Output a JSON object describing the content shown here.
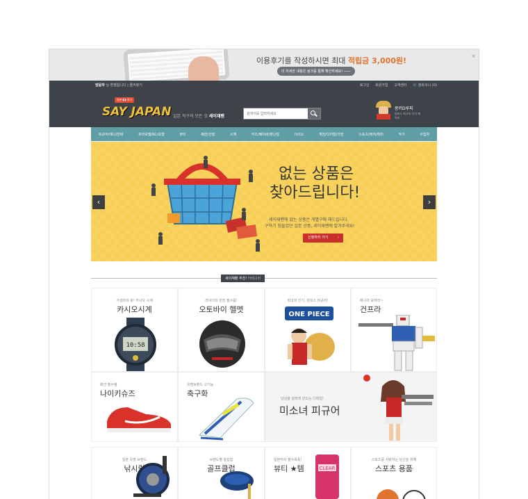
{
  "promo": {
    "text_prefix": "이용후기를 작성하시면 최대 ",
    "text_highlight": "적립금 3,000원!",
    "sub_button": "더 자세한 내용은 링크를 통해 확인하세요!  ――",
    "close": "×"
  },
  "topbar": {
    "greeting_name": "방문자",
    "greeting_text": " 님 환영합니다  |  즐겨찾기",
    "links": [
      "로그인",
      "회원가입",
      "고객센터",
      "🛒 장바구니 (0)"
    ]
  },
  "header": {
    "logo_badge": "일본 🇯🇵 직구",
    "logo": "SAY JAPAN",
    "tagline_prefix": "일본 직구의 모든 것 ",
    "tagline_bold": "세이재팬",
    "search_placeholder": "검색어를 입력하세요",
    "mascot_title": "몽키D루피",
    "mascot_sub": "원피스 최고의 인기 캐릭터"
  },
  "nav": [
    "피규어/애니/만화",
    "프라모델/RC/모형",
    "뷰티",
    "패션/신발",
    "시계",
    "키즈/베이비/장난감",
    "다이소",
    "게임/디지털/가전",
    "스포츠/레저/취미",
    "악기",
    "수입차"
  ],
  "hero": {
    "title1": "없는 상품은",
    "title2": "찾아드립니다!",
    "desc1": "세이재팬에 없는 상품은 개별구매 해드립니다.",
    "desc2": "구하기 힘들었던 일본 상품, 세이재팬에 맡겨주세요!",
    "button": "신청하러 가기",
    "button_arrow": "›",
    "prev": "‹",
    "next": "›"
  },
  "section": {
    "title_bold": "세이재팬 추천!",
    "title_rest": " 카테고리"
  },
  "categories": [
    {
      "sub": "가성비의 왕! 카시오 시계",
      "title": "카시오시계"
    },
    {
      "sub": "라이더의 안전 필수품!",
      "title": "오토바이 헬멧"
    },
    {
      "sub": "최고의 인기, 원피스 피규어!",
      "title": ""
    },
    {
      "sub": "매니아 모여라~",
      "title": "건프라"
    },
    {
      "sub": "패션 필수템",
      "title": "나이키슈즈"
    },
    {
      "sub": "유명브랜드 고기능",
      "title": "축구화"
    },
    {
      "sub": "남심을 설레게 만드는 디테일!",
      "title": "미소녀 피규어"
    },
    {
      "sub": "일본 유명 브랜드",
      "title": "낚시릴"
    },
    {
      "sub": "브랜드별 총집합",
      "title": "골프클럽"
    },
    {
      "sub": "일본여자 필수욕폭!",
      "title": "뷰티 ★템"
    },
    {
      "sub": "스포츠를 사랑하는 당신을 위해",
      "title": "스포츠 용품"
    }
  ],
  "colors": {
    "dark": "#3e434a",
    "nav": "#5f9ea4",
    "hero": "#f7cf55",
    "accent": "#c8302b",
    "logo": "#f3c23b"
  }
}
